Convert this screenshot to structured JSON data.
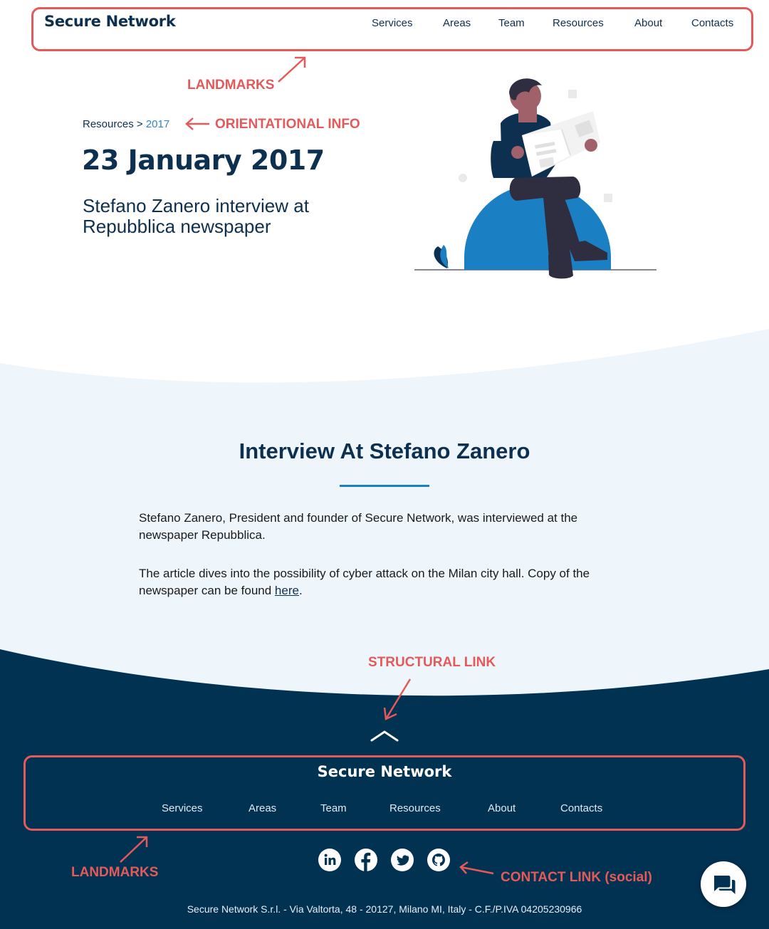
{
  "header": {
    "logo": "Secure Network",
    "nav": [
      "Services",
      "Areas",
      "Team",
      "Resources",
      "About",
      "Contacts"
    ]
  },
  "hero": {
    "breadcrumb_parent": "Resources",
    "breadcrumb_sep": ">",
    "breadcrumb_current": "2017",
    "date": "23 January 2017",
    "subtitle": "Stefano Zanero interview at Repubblica newspaper"
  },
  "content": {
    "title": "Interview At Stefano Zanero",
    "paragraph1": "Stefano Zanero, President and founder of Secure Network, was interviewed at the newspaper Repubblica.",
    "paragraph2_text": "The article dives into the possibility of cyber attack on the Milan city hall. Copy of the newspaper can be found ",
    "paragraph2_link": "here",
    "paragraph2_end": "."
  },
  "footer": {
    "logo": "Secure Network",
    "nav": [
      "Services",
      "Areas",
      "Team",
      "Resources",
      "About",
      "Contacts"
    ],
    "social": [
      "linkedin-icon",
      "facebook-icon",
      "twitter-icon",
      "github-icon"
    ],
    "address": "Secure Network S.r.l. - Via Valtorta, 48 - 20127, Milano MI, Italy - C.F./P.IVA 04205230966"
  },
  "annotations": {
    "landmarks_top": "LANDMARKS",
    "orientational": "ORIENTATIONAL INFO",
    "structural": "STRUCTURAL LINK",
    "landmarks_bottom": "LANDMARKS",
    "contact": "CONTACT LINK (social)"
  },
  "colors": {
    "navy": "#0d3050",
    "footer_bg": "#023252",
    "content_bg": "#eef6fc",
    "accent": "#1b7fc4",
    "annotation": "#e45a5a"
  }
}
